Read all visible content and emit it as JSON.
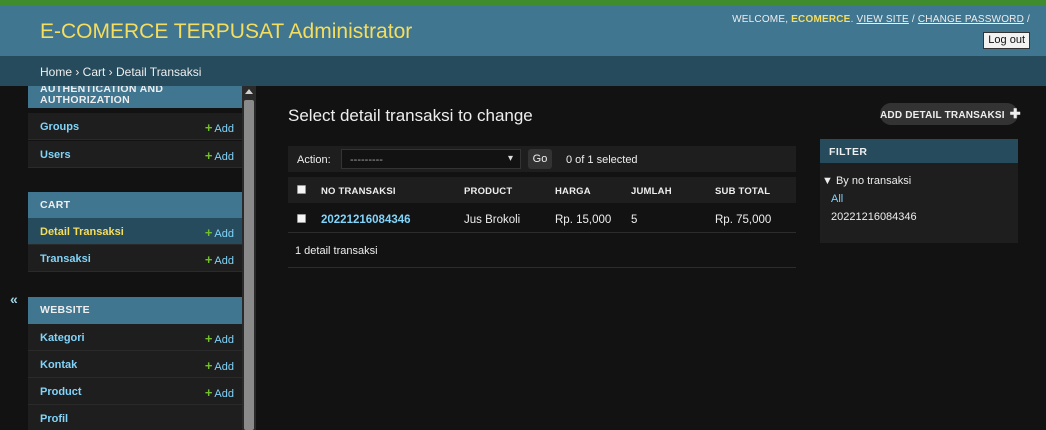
{
  "header": {
    "site_title": "E-COMERCE TERPUSAT Administrator",
    "welcome_text": "WELCOME,",
    "username": "ECOMERCE",
    "view_site": "VIEW SITE",
    "change_password": "CHANGE PASSWORD",
    "separator": "/",
    "logout_label": "Log out"
  },
  "breadcrumbs": "Home › Cart › Detail Transaksi",
  "sidebar": {
    "collapse_glyph": "«",
    "add_label": "Add",
    "modules": [
      {
        "caption": "AUTHENTICATION AND AUTHORIZATION",
        "items": [
          {
            "label": "Groups",
            "has_add": true
          },
          {
            "label": "Users",
            "has_add": true
          }
        ]
      },
      {
        "caption": "CART",
        "items": [
          {
            "label": "Detail Transaksi",
            "has_add": true,
            "active": true
          },
          {
            "label": "Transaksi",
            "has_add": true
          }
        ]
      },
      {
        "caption": "WEBSITE",
        "items": [
          {
            "label": "Kategori",
            "has_add": true
          },
          {
            "label": "Kontak",
            "has_add": true
          },
          {
            "label": "Product",
            "has_add": true
          },
          {
            "label": "Profil",
            "has_add": false
          }
        ]
      }
    ]
  },
  "content": {
    "title": "Select detail transaksi to change",
    "add_button": "ADD DETAIL TRANSAKSI",
    "actions": {
      "label": "Action:",
      "selected": "---------",
      "go_label": "Go",
      "counter": "0 of 1 selected"
    },
    "table": {
      "columns": [
        "NO TRANSAKSI",
        "PRODUCT",
        "HARGA",
        "JUMLAH",
        "SUB TOTAL"
      ],
      "rows": [
        [
          "20221216084346",
          "Jus Brokoli",
          "Rp. 15,000",
          "5",
          "Rp. 75,000"
        ]
      ]
    },
    "paginator": "1 detail transaksi"
  },
  "filter": {
    "title": "FILTER",
    "group_title": "▼ By no transaksi",
    "options": [
      {
        "label": "All",
        "selected": true
      },
      {
        "label": "20221216084346",
        "selected": false
      }
    ]
  },
  "colors": {
    "header_bg": "#417690",
    "breadcrumb_bg": "#264b5d",
    "title_yellow": "#f5dd5d",
    "link_blue": "#81d4fa",
    "add_green": "#70bf2b",
    "body_bg": "#121212"
  }
}
